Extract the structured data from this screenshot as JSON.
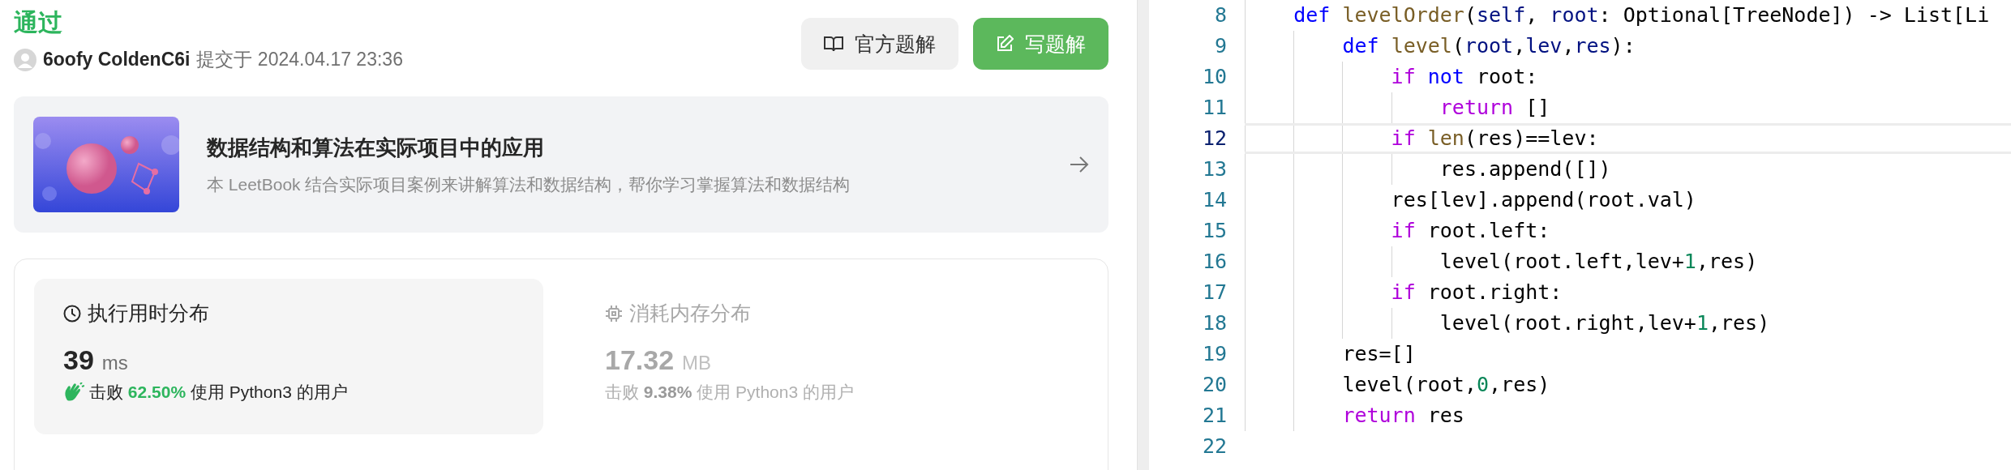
{
  "status": "通过",
  "submission": {
    "user": "6oofy ColdenC6i",
    "submitted": "提交于 2024.04.17 23:36"
  },
  "buttons": [
    {
      "label": "官方题解",
      "kind": "secondary"
    },
    {
      "label": "写题解",
      "kind": "primary"
    }
  ],
  "leetbook": {
    "kind": "picture",
    "title": "数据结构和算法在实际项目中的应用",
    "description": "本 LeetBook 结合实际项目案例来讲解算法和数据结构，帮你学习掌握算法和数据结构"
  },
  "stats": [
    {
      "kind": "runtime",
      "title": "执行用时分布",
      "selected": true,
      "value": "39",
      "unit": "ms",
      "beats": "击败 **62.50%** 使用 Python3 的用户"
    },
    {
      "kind": "memory",
      "title": "消耗内存分布",
      "selected": false,
      "value": "17.32",
      "unit": "MB",
      "beats": "击败 **9.38%** 使用 Python3 的用户"
    }
  ],
  "editor": {
    "lines": [
      {
        "number": "8",
        "selected": false,
        "tokens": [
          {
            "kind": "storage",
            "text": "    def"
          },
          {
            "kind": "function",
            "text": " levelOrder"
          },
          {
            "kind": "plain",
            "text": "("
          },
          {
            "kind": "param",
            "text": "self"
          },
          {
            "kind": "plain",
            "text": ", "
          },
          {
            "kind": "param",
            "text": "root"
          },
          {
            "kind": "plain",
            "text": ": Optional[TreeNode]) -> List[Li"
          }
        ]
      },
      {
        "number": "9",
        "selected": false,
        "tokens": [
          {
            "kind": "storage",
            "text": "        def"
          },
          {
            "kind": "function",
            "text": " level"
          },
          {
            "kind": "plain",
            "text": "("
          },
          {
            "kind": "param",
            "text": "root"
          },
          {
            "kind": "plain",
            "text": ","
          },
          {
            "kind": "param",
            "text": "lev"
          },
          {
            "kind": "plain",
            "text": ","
          },
          {
            "kind": "param",
            "text": "res"
          },
          {
            "kind": "plain",
            "text": "):"
          }
        ]
      },
      {
        "number": "10",
        "selected": false,
        "tokens": [
          {
            "kind": "keyword",
            "text": "            if"
          },
          {
            "kind": "storage",
            "text": " not"
          },
          {
            "kind": "plain",
            "text": " root:"
          }
        ]
      },
      {
        "number": "11",
        "selected": false,
        "tokens": [
          {
            "kind": "keyword",
            "text": "                return"
          },
          {
            "kind": "plain",
            "text": " []"
          }
        ]
      },
      {
        "number": "12",
        "selected": true,
        "tokens": [
          {
            "kind": "keyword",
            "text": "            if"
          },
          {
            "kind": "function",
            "text": " len"
          },
          {
            "kind": "plain",
            "text": "(res)==lev:"
          }
        ]
      },
      {
        "number": "13",
        "selected": false,
        "tokens": [
          {
            "kind": "plain",
            "text": "                res.append([])"
          }
        ]
      },
      {
        "number": "14",
        "selected": false,
        "tokens": [
          {
            "kind": "plain",
            "text": "            res[lev].append(root.val)"
          }
        ]
      },
      {
        "number": "15",
        "selected": false,
        "tokens": [
          {
            "kind": "keyword",
            "text": "            if"
          },
          {
            "kind": "plain",
            "text": " root.left:"
          }
        ]
      },
      {
        "number": "16",
        "selected": false,
        "tokens": [
          {
            "kind": "plain",
            "text": "                level(root.left,lev+"
          },
          {
            "kind": "number",
            "text": "1"
          },
          {
            "kind": "plain",
            "text": ",res)"
          }
        ]
      },
      {
        "number": "17",
        "selected": false,
        "tokens": [
          {
            "kind": "keyword",
            "text": "            if"
          },
          {
            "kind": "plain",
            "text": " root.right:"
          }
        ]
      },
      {
        "number": "18",
        "selected": false,
        "tokens": [
          {
            "kind": "plain",
            "text": "                level(root.right,lev+"
          },
          {
            "kind": "number",
            "text": "1"
          },
          {
            "kind": "plain",
            "text": ",res)"
          }
        ]
      },
      {
        "number": "19",
        "selected": false,
        "tokens": [
          {
            "kind": "plain",
            "text": "        res=[]"
          }
        ]
      },
      {
        "number": "20",
        "selected": false,
        "tokens": [
          {
            "kind": "plain",
            "text": "        level(root,"
          },
          {
            "kind": "number",
            "text": "0"
          },
          {
            "kind": "plain",
            "text": ",res)"
          }
        ]
      },
      {
        "number": "21",
        "selected": false,
        "tokens": [
          {
            "kind": "keyword",
            "text": "        return"
          },
          {
            "kind": "plain",
            "text": " res"
          }
        ]
      },
      {
        "number": "22",
        "selected": false
      }
    ]
  }
}
